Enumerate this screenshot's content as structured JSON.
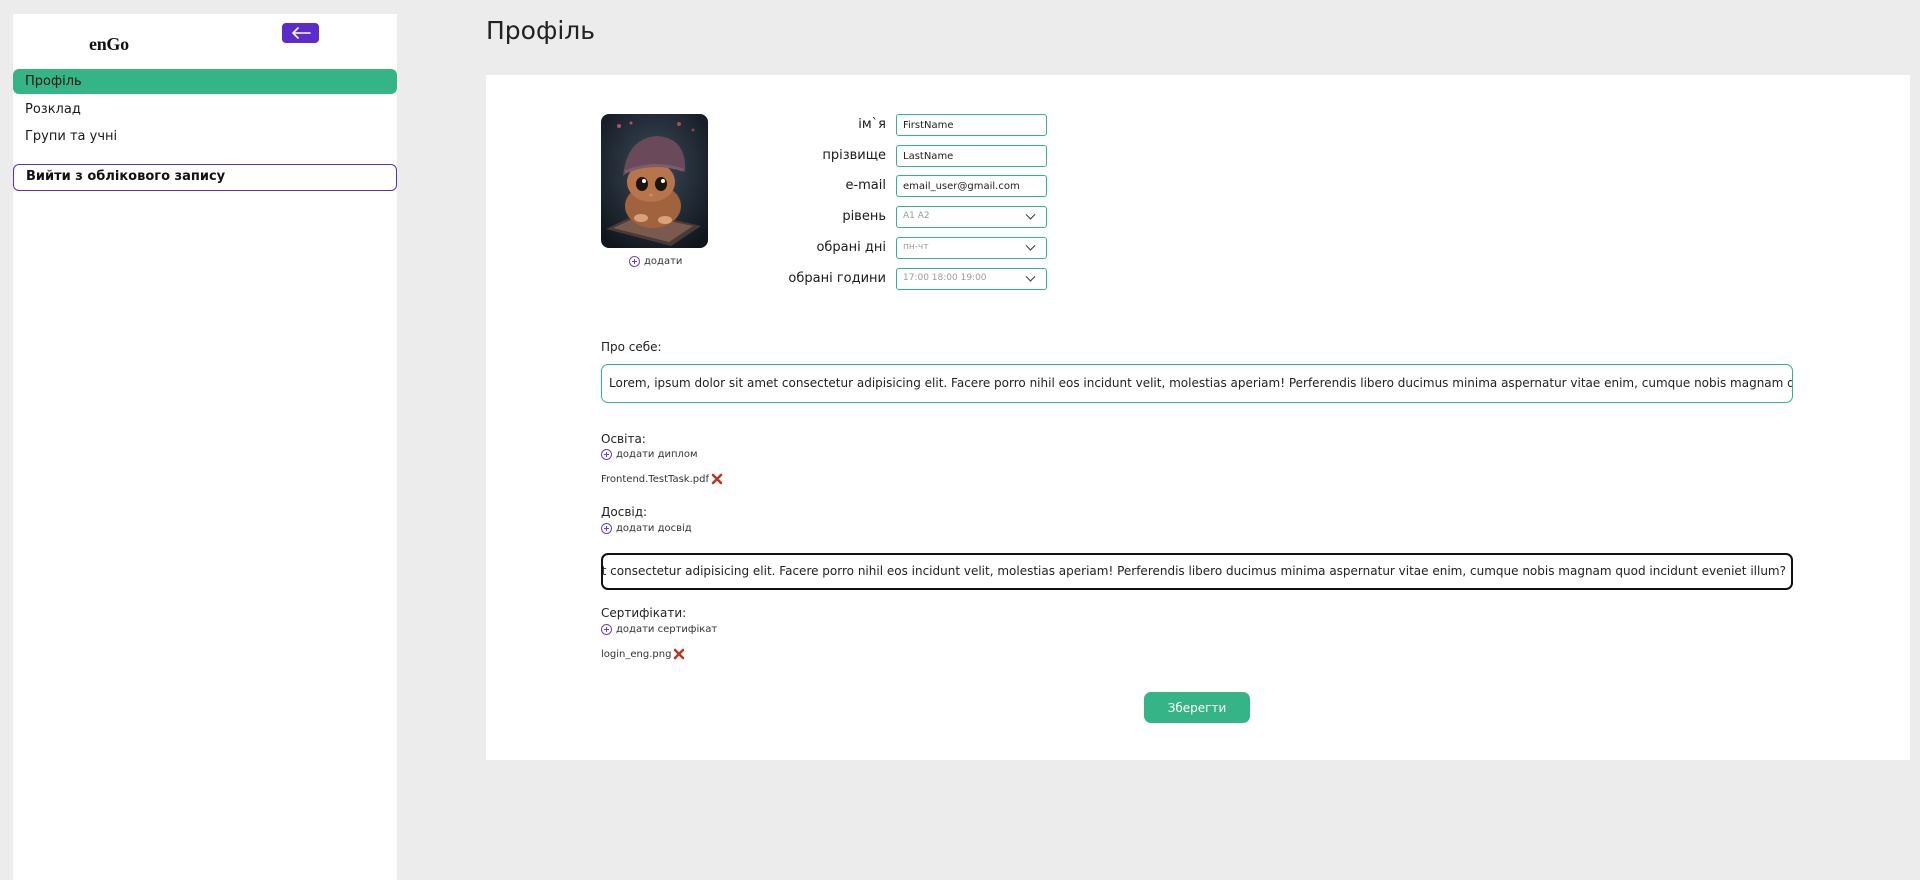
{
  "app": {
    "brand": "enGo"
  },
  "sidebar": {
    "items": [
      {
        "label": "Профіль"
      },
      {
        "label": "Розклад"
      },
      {
        "label": "Групи та учні"
      }
    ],
    "logout_label": "Вийти з облікового запису"
  },
  "page": {
    "title": "Профіль"
  },
  "profile": {
    "add_photo_label": "додати",
    "fields": {
      "first_name": {
        "label": "ім`я",
        "value": "FirstName"
      },
      "last_name": {
        "label": "прізвище",
        "value": "LastName"
      },
      "email": {
        "label": "e-mail",
        "value": "email_user@gmail.com"
      },
      "level": {
        "label": "рівень",
        "value": "A1  A2"
      },
      "days": {
        "label": "обрані дні",
        "value": "пн-чт"
      },
      "hours": {
        "label": "обрані години",
        "value": "17:00  18:00  19:00"
      }
    },
    "about": {
      "label": "Про себе:",
      "value": "Lorem, ipsum dolor sit amet consectetur adipisicing elit. Facere porro nihil eos incidunt velit, molestias aperiam! Perferendis libero ducimus minima aspernatur vitae enim, cumque nobis magnam quod incidunt eveniet illum?"
    },
    "education": {
      "label": "Освіта:",
      "add_label": "додати диплом",
      "files": [
        "Frontend.TestTask.pdf"
      ]
    },
    "experience": {
      "label": "Досвід:",
      "add_label": "додати досвід",
      "value": "Lorem, ipsum dolor sit amet consectetur adipisicing elit. Facere porro nihil eos incidunt velit, molestias aperiam! Perferendis libero ducimus minima aspernatur vitae enim, cumque nobis magnam quod incidunt eveniet illum?"
    },
    "certificates": {
      "label": "Сертифікати:",
      "add_label": "додати сертифікат",
      "files": [
        "login_eng.png"
      ]
    },
    "save_label": "Зберегти"
  },
  "colors": {
    "accent_green": "#34b487",
    "accent_purple": "#5b2cc9",
    "delete_red": "#b33a2a"
  }
}
